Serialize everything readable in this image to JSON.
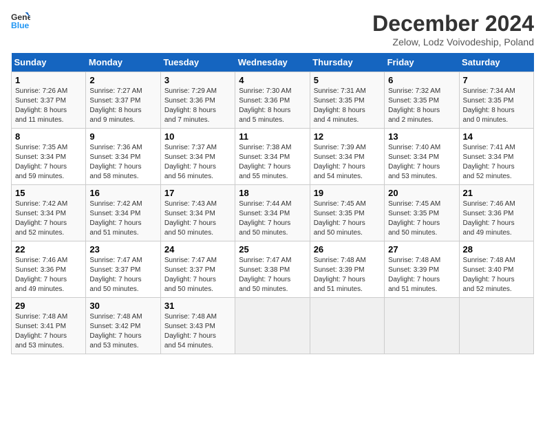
{
  "header": {
    "logo_line1": "General",
    "logo_line2": "Blue",
    "main_title": "December 2024",
    "subtitle": "Zelow, Lodz Voivodeship, Poland"
  },
  "weekdays": [
    "Sunday",
    "Monday",
    "Tuesday",
    "Wednesday",
    "Thursday",
    "Friday",
    "Saturday"
  ],
  "weeks": [
    [
      {
        "day": "1",
        "info": "Sunrise: 7:26 AM\nSunset: 3:37 PM\nDaylight: 8 hours\nand 11 minutes."
      },
      {
        "day": "2",
        "info": "Sunrise: 7:27 AM\nSunset: 3:37 PM\nDaylight: 8 hours\nand 9 minutes."
      },
      {
        "day": "3",
        "info": "Sunrise: 7:29 AM\nSunset: 3:36 PM\nDaylight: 8 hours\nand 7 minutes."
      },
      {
        "day": "4",
        "info": "Sunrise: 7:30 AM\nSunset: 3:36 PM\nDaylight: 8 hours\nand 5 minutes."
      },
      {
        "day": "5",
        "info": "Sunrise: 7:31 AM\nSunset: 3:35 PM\nDaylight: 8 hours\nand 4 minutes."
      },
      {
        "day": "6",
        "info": "Sunrise: 7:32 AM\nSunset: 3:35 PM\nDaylight: 8 hours\nand 2 minutes."
      },
      {
        "day": "7",
        "info": "Sunrise: 7:34 AM\nSunset: 3:35 PM\nDaylight: 8 hours\nand 0 minutes."
      }
    ],
    [
      {
        "day": "8",
        "info": "Sunrise: 7:35 AM\nSunset: 3:34 PM\nDaylight: 7 hours\nand 59 minutes."
      },
      {
        "day": "9",
        "info": "Sunrise: 7:36 AM\nSunset: 3:34 PM\nDaylight: 7 hours\nand 58 minutes."
      },
      {
        "day": "10",
        "info": "Sunrise: 7:37 AM\nSunset: 3:34 PM\nDaylight: 7 hours\nand 56 minutes."
      },
      {
        "day": "11",
        "info": "Sunrise: 7:38 AM\nSunset: 3:34 PM\nDaylight: 7 hours\nand 55 minutes."
      },
      {
        "day": "12",
        "info": "Sunrise: 7:39 AM\nSunset: 3:34 PM\nDaylight: 7 hours\nand 54 minutes."
      },
      {
        "day": "13",
        "info": "Sunrise: 7:40 AM\nSunset: 3:34 PM\nDaylight: 7 hours\nand 53 minutes."
      },
      {
        "day": "14",
        "info": "Sunrise: 7:41 AM\nSunset: 3:34 PM\nDaylight: 7 hours\nand 52 minutes."
      }
    ],
    [
      {
        "day": "15",
        "info": "Sunrise: 7:42 AM\nSunset: 3:34 PM\nDaylight: 7 hours\nand 52 minutes."
      },
      {
        "day": "16",
        "info": "Sunrise: 7:42 AM\nSunset: 3:34 PM\nDaylight: 7 hours\nand 51 minutes."
      },
      {
        "day": "17",
        "info": "Sunrise: 7:43 AM\nSunset: 3:34 PM\nDaylight: 7 hours\nand 50 minutes."
      },
      {
        "day": "18",
        "info": "Sunrise: 7:44 AM\nSunset: 3:34 PM\nDaylight: 7 hours\nand 50 minutes."
      },
      {
        "day": "19",
        "info": "Sunrise: 7:45 AM\nSunset: 3:35 PM\nDaylight: 7 hours\nand 50 minutes."
      },
      {
        "day": "20",
        "info": "Sunrise: 7:45 AM\nSunset: 3:35 PM\nDaylight: 7 hours\nand 50 minutes."
      },
      {
        "day": "21",
        "info": "Sunrise: 7:46 AM\nSunset: 3:36 PM\nDaylight: 7 hours\nand 49 minutes."
      }
    ],
    [
      {
        "day": "22",
        "info": "Sunrise: 7:46 AM\nSunset: 3:36 PM\nDaylight: 7 hours\nand 49 minutes."
      },
      {
        "day": "23",
        "info": "Sunrise: 7:47 AM\nSunset: 3:37 PM\nDaylight: 7 hours\nand 50 minutes."
      },
      {
        "day": "24",
        "info": "Sunrise: 7:47 AM\nSunset: 3:37 PM\nDaylight: 7 hours\nand 50 minutes."
      },
      {
        "day": "25",
        "info": "Sunrise: 7:47 AM\nSunset: 3:38 PM\nDaylight: 7 hours\nand 50 minutes."
      },
      {
        "day": "26",
        "info": "Sunrise: 7:48 AM\nSunset: 3:39 PM\nDaylight: 7 hours\nand 51 minutes."
      },
      {
        "day": "27",
        "info": "Sunrise: 7:48 AM\nSunset: 3:39 PM\nDaylight: 7 hours\nand 51 minutes."
      },
      {
        "day": "28",
        "info": "Sunrise: 7:48 AM\nSunset: 3:40 PM\nDaylight: 7 hours\nand 52 minutes."
      }
    ],
    [
      {
        "day": "29",
        "info": "Sunrise: 7:48 AM\nSunset: 3:41 PM\nDaylight: 7 hours\nand 53 minutes."
      },
      {
        "day": "30",
        "info": "Sunrise: 7:48 AM\nSunset: 3:42 PM\nDaylight: 7 hours\nand 53 minutes."
      },
      {
        "day": "31",
        "info": "Sunrise: 7:48 AM\nSunset: 3:43 PM\nDaylight: 7 hours\nand 54 minutes."
      },
      {
        "day": "",
        "info": ""
      },
      {
        "day": "",
        "info": ""
      },
      {
        "day": "",
        "info": ""
      },
      {
        "day": "",
        "info": ""
      }
    ]
  ]
}
